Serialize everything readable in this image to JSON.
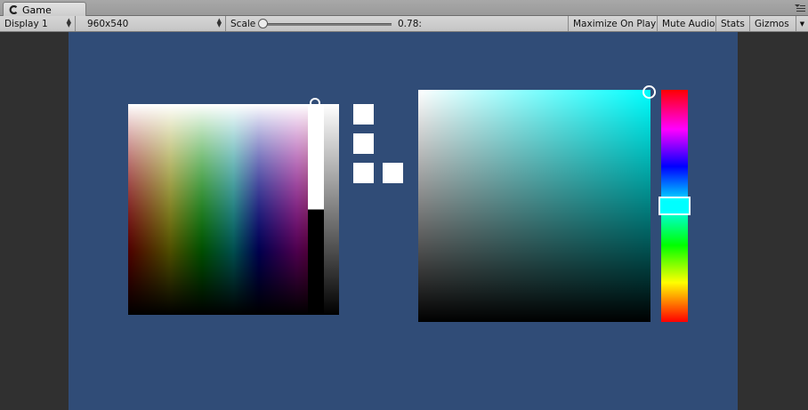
{
  "tabs": [
    {
      "label": "Game",
      "icon": "game-icon"
    }
  ],
  "toolbar": {
    "display": {
      "selected": "Display 1"
    },
    "resolution": {
      "selected": "960x540"
    },
    "scale": {
      "label": "Scale",
      "value": "0.78:"
    },
    "maximize_on_play": "Maximize On Play",
    "mute_audio": "Mute Audio",
    "stats": "Stats",
    "gizmos": "Gizmos"
  },
  "colors": {
    "game_background": "#304c77",
    "editor_background": "#2f2f2f",
    "selected_hue": "#00ffff",
    "swatch": "#ffffff"
  }
}
